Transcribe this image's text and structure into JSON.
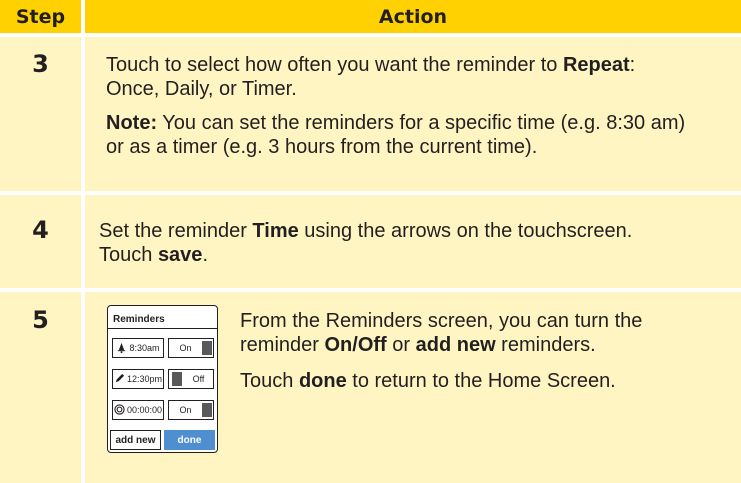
{
  "header": {
    "step": "Step",
    "action": "Action"
  },
  "rows": [
    {
      "step": "3",
      "line1_pre": "Touch to select how often you want the reminder to ",
      "line1_bold": "Repeat",
      "line1_post": ":",
      "line2": "Once, Daily, or Timer.",
      "note_label": "Note:",
      "note_line1": " You can set the reminders for a specific time (e.g. 8:30 am)",
      "note_line2": "or as a timer (e.g. 3 hours from the current time)."
    },
    {
      "step": "4",
      "line1_pre": "Set the reminder ",
      "line1_bold": "Time",
      "line1_post": " using the arrows on the touchscreen.",
      "line2_pre": "Touch ",
      "line2_bold": "save",
      "line2_post": "."
    },
    {
      "step": "5",
      "line1": "From the Reminders screen, you can turn the",
      "line2_pre": "reminder ",
      "line2_bold1": "On/Off",
      "line2_mid": " or ",
      "line2_bold2": "add new",
      "line2_post": " reminders.",
      "line3_pre": "Touch ",
      "line3_bold": "done",
      "line3_post": " to return to the Home Screen."
    }
  ],
  "device": {
    "title": "Reminders",
    "reminders": [
      {
        "icon": "bell-icon",
        "time": "8:30am",
        "state": "On"
      },
      {
        "icon": "pen-icon",
        "time": "12:30pm",
        "state": "Off"
      },
      {
        "icon": "timer-icon",
        "time": "00:00:00",
        "state": "On"
      }
    ],
    "add_new": "add new",
    "done": "done"
  },
  "colors": {
    "header": "#ffd100",
    "cell": "#fff5c2",
    "done_button": "#4f8fcf"
  }
}
